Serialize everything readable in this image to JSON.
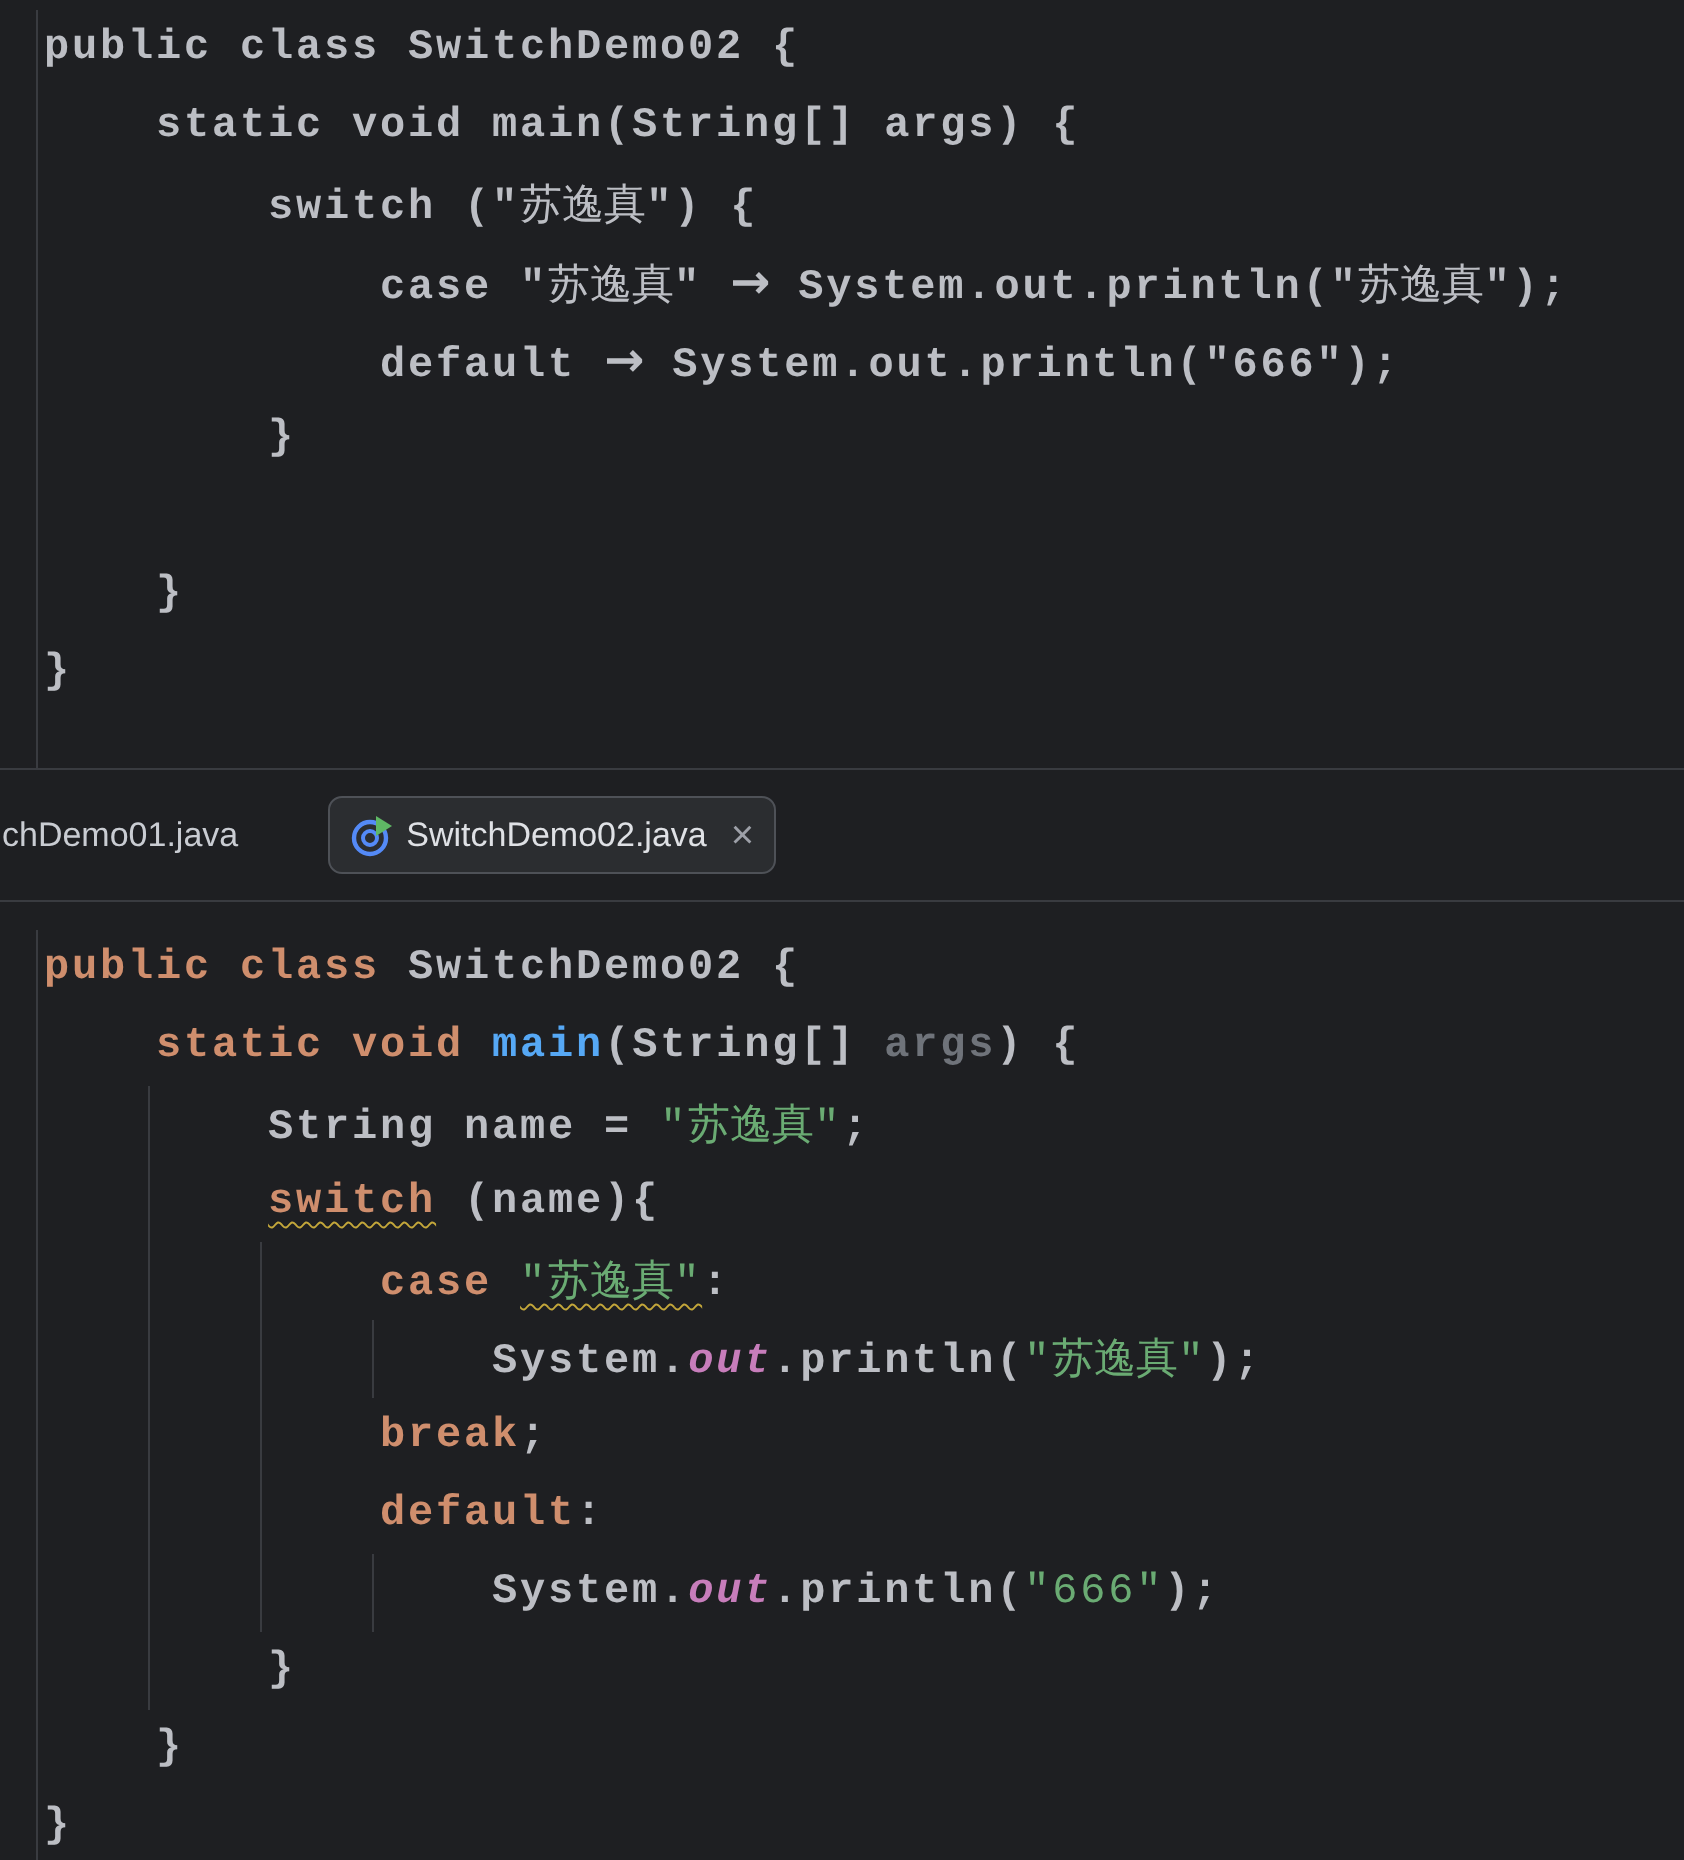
{
  "top_editor": {
    "indent_guides": false,
    "lines": [
      {
        "kind": "code",
        "tokens": [
          {
            "text": "public class SwitchDemo02 {"
          }
        ]
      },
      {
        "kind": "code",
        "tokens": [
          {
            "text": "    static void main(String[] args) {"
          }
        ]
      },
      {
        "kind": "code",
        "tokens": [
          {
            "text": "        switch (\"苏逸真\") {"
          }
        ]
      },
      {
        "kind": "code",
        "tokens": [
          {
            "text": "            case \"苏逸真\" → System.out.println(\"苏逸真\");"
          }
        ]
      },
      {
        "kind": "code",
        "tokens": [
          {
            "text": "            default → System.out.println(\"666\");"
          }
        ]
      },
      {
        "kind": "code",
        "tokens": [
          {
            "text": "        }"
          }
        ]
      },
      {
        "kind": "blank"
      },
      {
        "kind": "code",
        "tokens": [
          {
            "text": "    }"
          }
        ]
      },
      {
        "kind": "code",
        "tokens": [
          {
            "text": "}"
          }
        ]
      }
    ]
  },
  "tabs": [
    {
      "label": "chDemo01.java",
      "selected": false
    },
    {
      "label": "SwitchDemo02.java",
      "selected": true,
      "close": "×"
    }
  ],
  "bottom_editor": {
    "indent_guides": true,
    "lines": [
      {
        "kind": "code",
        "tokens": [
          {
            "text": "public class ",
            "kind": "keyword"
          },
          {
            "text": "SwitchDemo02 {",
            "kind": "plain"
          }
        ]
      },
      {
        "kind": "code",
        "tokens": [
          {
            "text": "    static void ",
            "kind": "keyword"
          },
          {
            "text": "main",
            "kind": "method"
          },
          {
            "text": "(String[] ",
            "kind": "plain"
          },
          {
            "text": "args",
            "kind": "unused"
          },
          {
            "text": ") {",
            "kind": "plain"
          }
        ]
      },
      {
        "kind": "code",
        "tokens": [
          {
            "text": "        String name = ",
            "kind": "plain"
          },
          {
            "text": "\"苏逸真\"",
            "kind": "string"
          },
          {
            "text": ";",
            "kind": "plain"
          }
        ]
      },
      {
        "kind": "code",
        "tokens": [
          {
            "text": "        switch",
            "kind": "keyword",
            "warning": true
          },
          {
            "text": " (name){",
            "kind": "plain"
          }
        ]
      },
      {
        "kind": "code",
        "tokens": [
          {
            "text": "            case ",
            "kind": "keyword"
          },
          {
            "text": "\"苏逸真\"",
            "kind": "string",
            "warning": true
          },
          {
            "text": ":",
            "kind": "plain"
          }
        ]
      },
      {
        "kind": "code",
        "tokens": [
          {
            "text": "                System.",
            "kind": "plain"
          },
          {
            "text": "out",
            "kind": "field"
          },
          {
            "text": ".println(",
            "kind": "plain"
          },
          {
            "text": "\"苏逸真\"",
            "kind": "string"
          },
          {
            "text": ");",
            "kind": "plain"
          }
        ]
      },
      {
        "kind": "code",
        "tokens": [
          {
            "text": "            break",
            "kind": "keyword"
          },
          {
            "text": ";",
            "kind": "plain"
          }
        ]
      },
      {
        "kind": "code",
        "tokens": [
          {
            "text": "            default",
            "kind": "keyword"
          },
          {
            "text": ":",
            "kind": "plain"
          }
        ]
      },
      {
        "kind": "code",
        "tokens": [
          {
            "text": "                System.",
            "kind": "plain"
          },
          {
            "text": "out",
            "kind": "field"
          },
          {
            "text": ".println(",
            "kind": "plain"
          },
          {
            "text": "\"666\"",
            "kind": "string"
          },
          {
            "text": ");",
            "kind": "plain"
          }
        ]
      },
      {
        "kind": "code",
        "tokens": [
          {
            "text": "        }",
            "kind": "plain"
          }
        ]
      },
      {
        "kind": "code",
        "tokens": [
          {
            "text": "    }",
            "kind": "plain"
          }
        ]
      },
      {
        "kind": "code",
        "tokens": [
          {
            "text": "}",
            "kind": "plain"
          }
        ]
      }
    ]
  }
}
